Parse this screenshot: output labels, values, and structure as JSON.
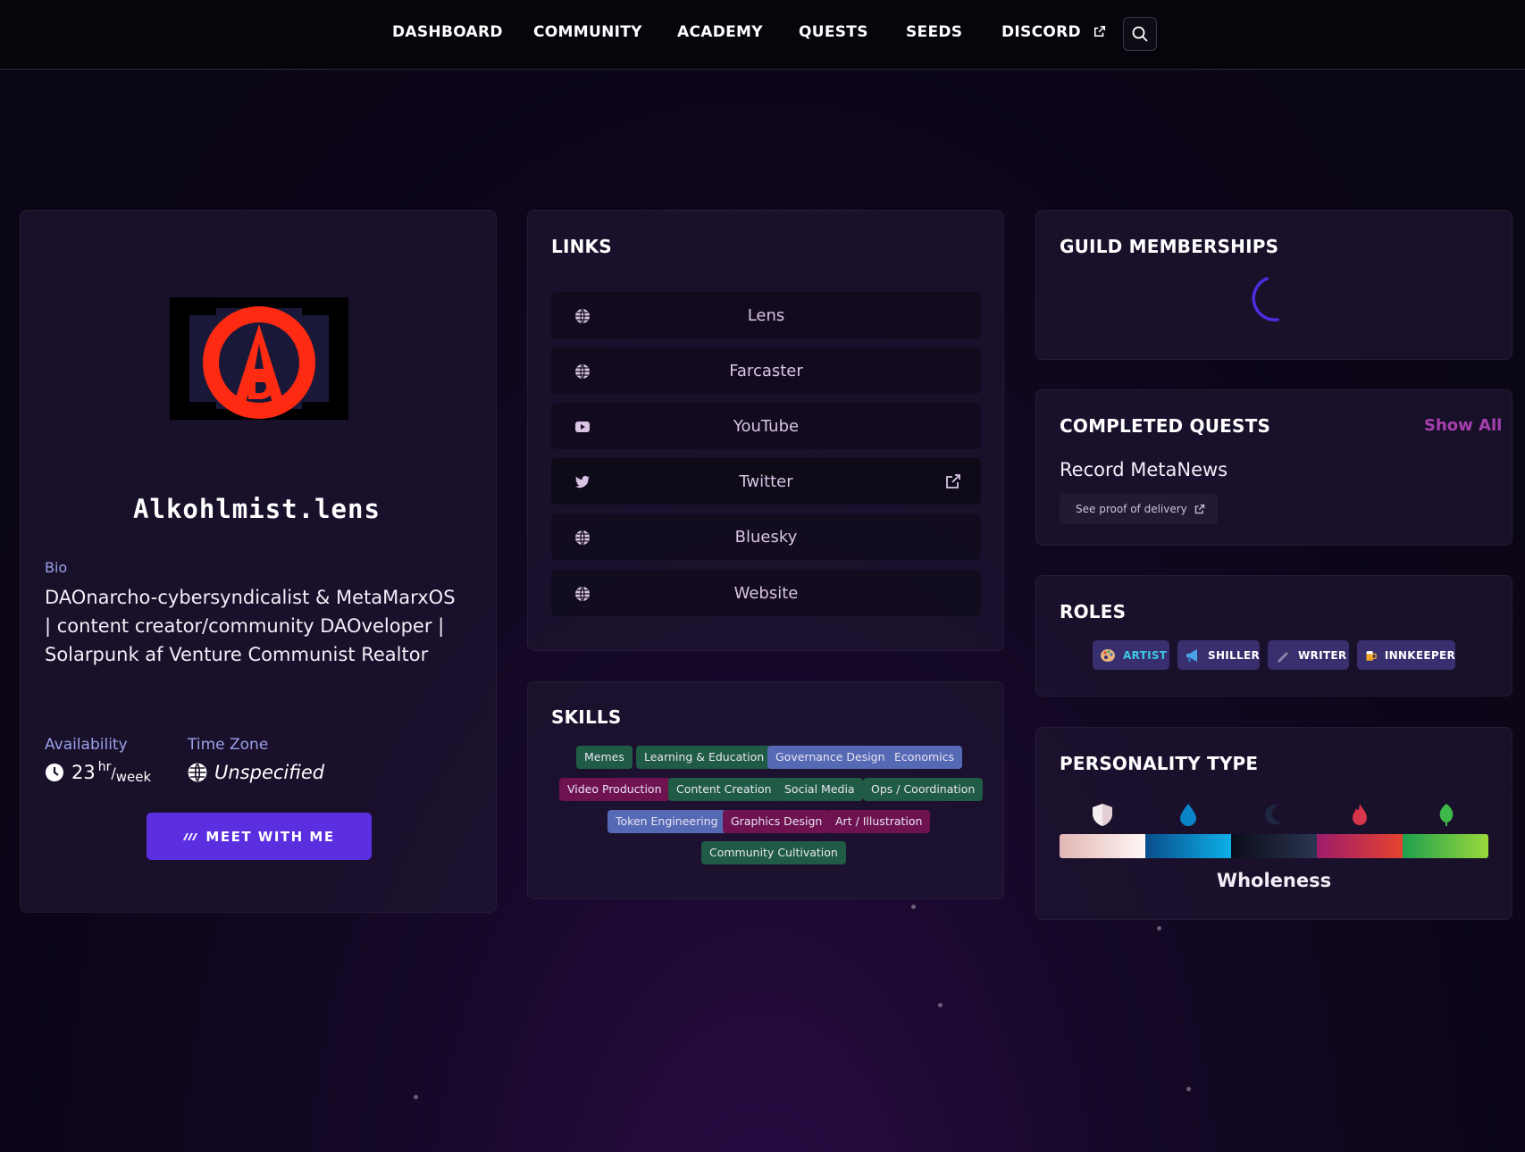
{
  "nav": {
    "items": [
      "DASHBOARD",
      "COMMUNITY",
      "ACADEMY",
      "QUESTS",
      "SEEDS",
      "DISCORD"
    ]
  },
  "profile": {
    "username": "Alkohlmist.lens",
    "bio_label": "Bio",
    "bio": "DAOnarcho-cybersyndicalist & MetaMarxOS | content creator/community DAOveloper | Solarpunk af Venture Communist Realtor",
    "availability_label": "Availability",
    "availability_value": "23",
    "availability_unit_top": "hr",
    "availability_unit_bottom": "week",
    "timezone_label": "Time Zone",
    "timezone_value": "Unspecified",
    "meet_button": "MEET WITH ME"
  },
  "links": {
    "title": "LINKS",
    "items": [
      {
        "label": "Lens",
        "icon": "globe-icon"
      },
      {
        "label": "Farcaster",
        "icon": "globe-icon"
      },
      {
        "label": "YouTube",
        "icon": "youtube-icon"
      },
      {
        "label": "Twitter",
        "icon": "twitter-icon"
      },
      {
        "label": "Bluesky",
        "icon": "globe-icon"
      },
      {
        "label": "Website",
        "icon": "globe-icon"
      }
    ]
  },
  "skills": {
    "title": "SKILLS",
    "items": [
      {
        "label": "Memes",
        "color": "green"
      },
      {
        "label": "Learning & Education",
        "color": "green"
      },
      {
        "label": "Governance Design",
        "color": "blue"
      },
      {
        "label": "Economics",
        "color": "blue"
      },
      {
        "label": "Video Production",
        "color": "magenta"
      },
      {
        "label": "Content Creation",
        "color": "green"
      },
      {
        "label": "Social Media",
        "color": "green"
      },
      {
        "label": "Ops / Coordination",
        "color": "green"
      },
      {
        "label": "Token Engineering",
        "color": "blue"
      },
      {
        "label": "Graphics Design",
        "color": "magenta"
      },
      {
        "label": "Art / Illustration",
        "color": "magenta"
      },
      {
        "label": "Community Cultivation",
        "color": "green"
      }
    ]
  },
  "guilds": {
    "title": "GUILD MEMBERSHIPS"
  },
  "quests": {
    "title": "COMPLETED QUESTS",
    "show_all": "Show All",
    "items": [
      {
        "name": "Record MetaNews",
        "proof": "See proof of delivery"
      }
    ]
  },
  "roles": {
    "title": "ROLES",
    "items": [
      {
        "label": "ARTIST",
        "color": "#3fc7e6"
      },
      {
        "label": "SHILLER",
        "color": "#ffffff"
      },
      {
        "label": "WRITER",
        "color": "#ffffff"
      },
      {
        "label": "INNKEEPER",
        "color": "#ffffff"
      }
    ]
  },
  "personality": {
    "title": "PERSONALITY TYPE",
    "result": "Wholeness",
    "colors": [
      "#f2ebe9",
      "#0a84c8",
      "#1a1f36",
      "#d6354a",
      "#3fb84a"
    ]
  }
}
